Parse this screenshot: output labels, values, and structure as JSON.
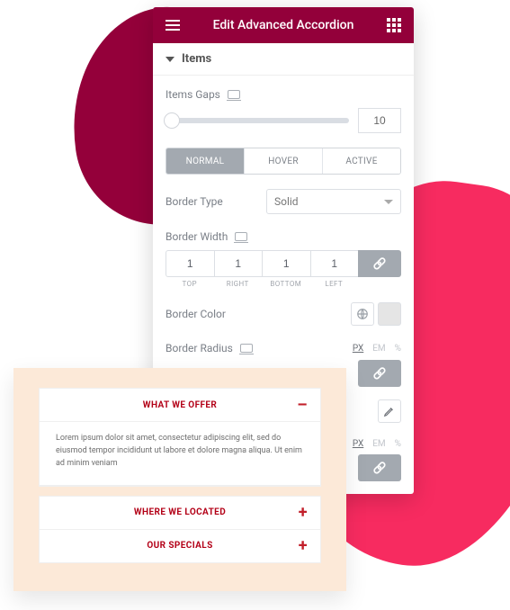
{
  "header": {
    "title": "Edit Advanced Accordion"
  },
  "section": {
    "title": "Items"
  },
  "items_gaps": {
    "label": "Items Gaps",
    "value": "10"
  },
  "state_tabs": {
    "normal": "NORMAL",
    "hover": "HOVER",
    "active": "ACTIVE"
  },
  "border_type": {
    "label": "Border Type",
    "value": "Solid"
  },
  "border_width": {
    "label": "Border Width",
    "top": "1",
    "right": "1",
    "bottom": "1",
    "left": "1",
    "sub_top": "TOP",
    "sub_right": "RIGHT",
    "sub_bottom": "BOTTOM",
    "sub_left": "LEFT"
  },
  "border_color": {
    "label": "Border Color",
    "swatch": "#e5e5e5"
  },
  "border_radius": {
    "label": "Border Radius"
  },
  "units": {
    "px": "PX",
    "em": "EM",
    "pct": "%"
  },
  "accordion": {
    "items": [
      {
        "title": "WHAT WE OFFER",
        "open": true,
        "toggle": "–"
      },
      {
        "title": "WHERE WE LOCATED",
        "open": false,
        "toggle": "+"
      },
      {
        "title": "OUR SPECIALS",
        "open": false,
        "toggle": "+"
      }
    ],
    "body": "Lorem ipsum dolor sit amet, consectetur adipiscing elit, sed do eiusmod tempor incididunt ut labore et dolore magna aliqua. Ut enim ad minim veniam"
  }
}
